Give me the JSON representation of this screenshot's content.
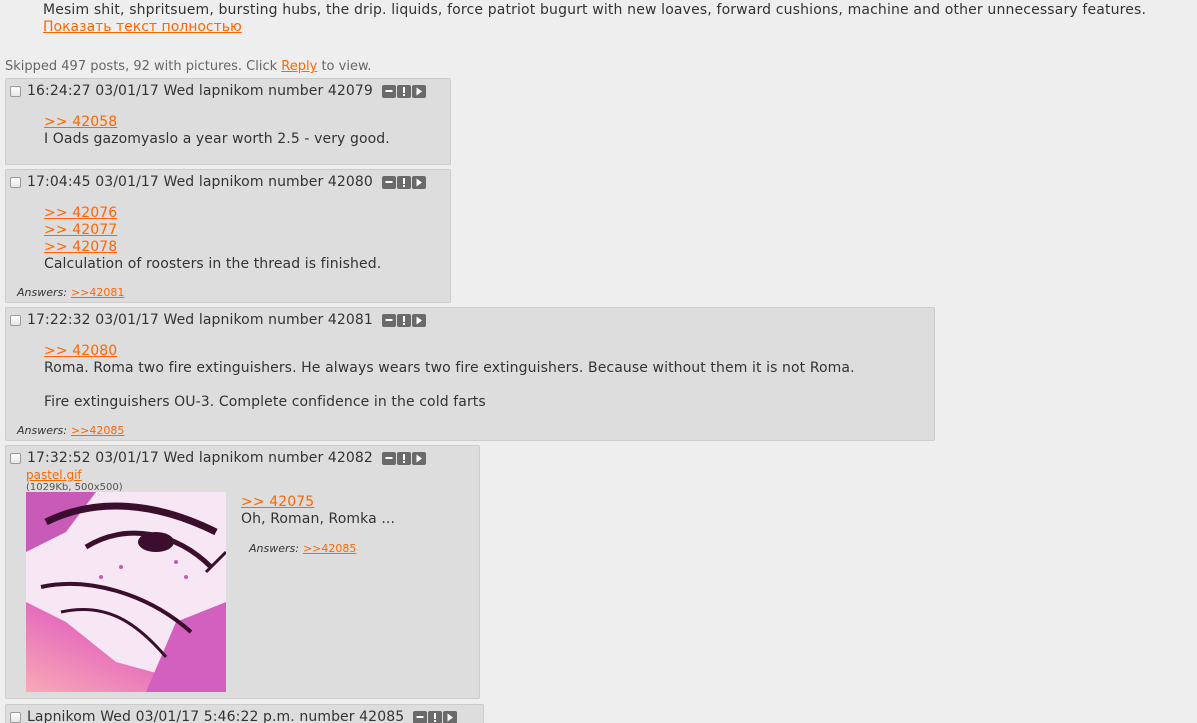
{
  "op": {
    "text": "Mesim shit, shpritsuem, bursting hubs, the drip. liquids, force patriot bugurt with new loaves, forward cushions, machine and other unnecessary features.",
    "expand_label": "Показать текст полностью"
  },
  "skipped": {
    "prefix": "Skipped 497 posts, 92 with pictures. Click",
    "link": "Reply",
    "suffix": "to view."
  },
  "answers_label": "Answers:",
  "posts": [
    {
      "header": "16:24:27 03/01/17 Wed lapnikom number 42079",
      "refs": [
        ">> 42058"
      ],
      "lines": [
        "I Oads gazomyaslo a year worth 2.5 - very good."
      ]
    },
    {
      "header": "17:04:45 03/01/17 Wed lapnikom number 42080",
      "refs": [
        ">> 42076",
        ">> 42077",
        ">> 42078"
      ],
      "lines": [
        "Calculation of roosters in the thread is finished."
      ],
      "answer": ">>42081"
    },
    {
      "header": "17:22:32 03/01/17 Wed lapnikom number 42081",
      "refs": [
        ">> 42080"
      ],
      "lines": [
        "Roma. Roma two fire extinguishers. He always wears two fire extinguishers. Because without them it is not Roma.",
        "",
        "Fire extinguishers OU-3. Complete confidence in the cold farts"
      ],
      "answer": ">>42085"
    },
    {
      "header": "17:32:52 03/01/17 Wed lapnikom number 42082",
      "file": {
        "name": "pastel.gif",
        "meta": "(1029Kb, 500x500)"
      },
      "refs": [
        ">> 42075"
      ],
      "lines": [
        "Oh, Roman, Romka ..."
      ],
      "answer": ">>42085"
    },
    {
      "header": "Lapnikom Wed 03/01/17 5:46:22 p.m. number 42085"
    }
  ],
  "icons": [
    "minus-icon",
    "exclamation-icon",
    "play-icon"
  ],
  "colors": {
    "link": "#ff6600",
    "post_bg": "#dddddd",
    "page_bg": "#eeeeee"
  }
}
